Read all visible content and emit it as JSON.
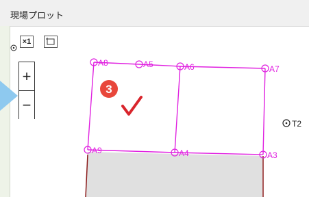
{
  "window": {
    "title": "現場プロット"
  },
  "toolbar": {
    "fit_icon": "fit-extent-icon",
    "fit_label": "×1",
    "frame_icon": "frame-select-icon"
  },
  "zoom": {
    "in_label": "+",
    "out_label": "−"
  },
  "step_badge": {
    "number": "3",
    "color": "#e8473b"
  },
  "check_mark": {
    "icon": "checkmark-icon",
    "color": "#d9252c"
  },
  "plot": {
    "line_color": "#e020e0",
    "lot_line_color": "#8b1a1a",
    "lot_fill": "#e0e0e0",
    "points": {
      "A8": "A8",
      "A5": "A5",
      "A6": "A6",
      "A7": "A7",
      "A9": "A9",
      "A4": "A4",
      "A3": "A3",
      "T2": "T2"
    }
  }
}
